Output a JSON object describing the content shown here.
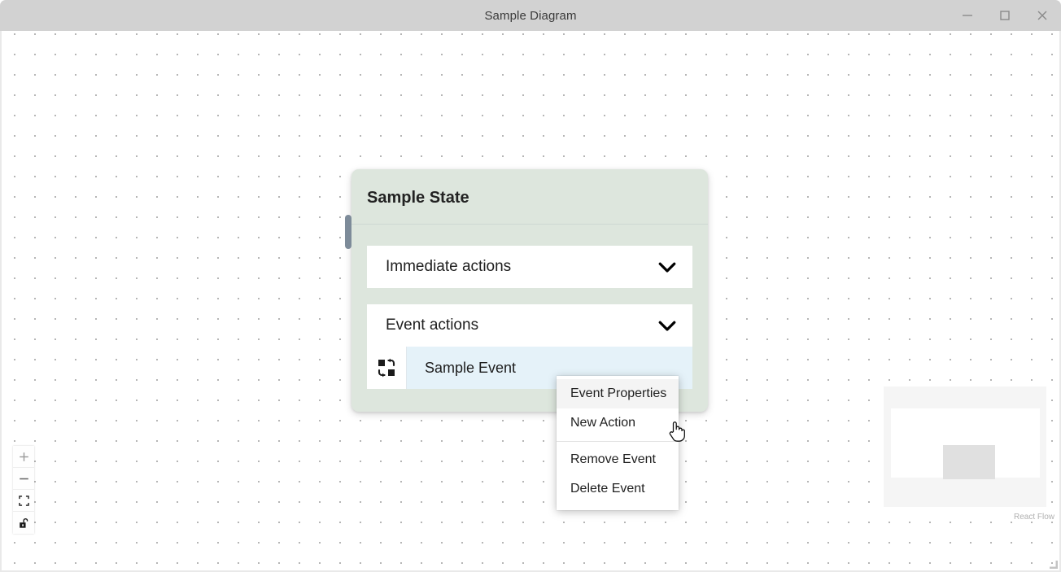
{
  "window": {
    "title": "Sample Diagram",
    "controls": [
      {
        "name": "minimize-button",
        "icon": "minimize-icon",
        "label": "Minimize"
      },
      {
        "name": "maximize-button",
        "icon": "maximize-icon",
        "label": "Maximize"
      },
      {
        "name": "close-button",
        "icon": "close-icon",
        "label": "Close"
      }
    ]
  },
  "canvas": {
    "background": "dot-grid",
    "dot_color": "#b4b4b4",
    "dot_spacing": 25
  },
  "node": {
    "title": "Sample State",
    "background_color": "#dde6dd",
    "handle_color": "#7d8b99",
    "sections": [
      {
        "label": "Immediate actions",
        "icon": "chevron-down-icon",
        "expanded": false
      },
      {
        "label": "Event actions",
        "icon": "chevron-down-icon",
        "expanded": true
      }
    ],
    "events": [
      {
        "name": "Sample Event",
        "icon": "event-exchange-icon",
        "selected": true,
        "highlight_color": "#e5f2f9"
      }
    ]
  },
  "context_menu": {
    "items": [
      {
        "label": "Event Properties",
        "hovered": true,
        "separator_after": false
      },
      {
        "label": "New Action",
        "hovered": false,
        "separator_after": true
      },
      {
        "label": "Remove Event",
        "hovered": false,
        "separator_after": false
      },
      {
        "label": "Delete Event",
        "hovered": false,
        "separator_after": false
      }
    ]
  },
  "controls": {
    "buttons": [
      {
        "name": "zoom-in-button",
        "icon": "plus-icon",
        "label": "Zoom in"
      },
      {
        "name": "zoom-out-button",
        "icon": "minus-icon",
        "label": "Zoom out"
      },
      {
        "name": "fit-view-button",
        "icon": "fit-view-icon",
        "label": "Fit view"
      },
      {
        "name": "toggle-interactivity-button",
        "icon": "unlock-icon",
        "label": "Toggle interactivity"
      }
    ]
  },
  "minimap": {
    "background_color": "#f5f5f5",
    "mask_color": "#ffffff",
    "node_color": "#e0e0e0"
  },
  "attribution": {
    "text": "React Flow"
  },
  "cursor": {
    "type": "pointer-hand"
  }
}
